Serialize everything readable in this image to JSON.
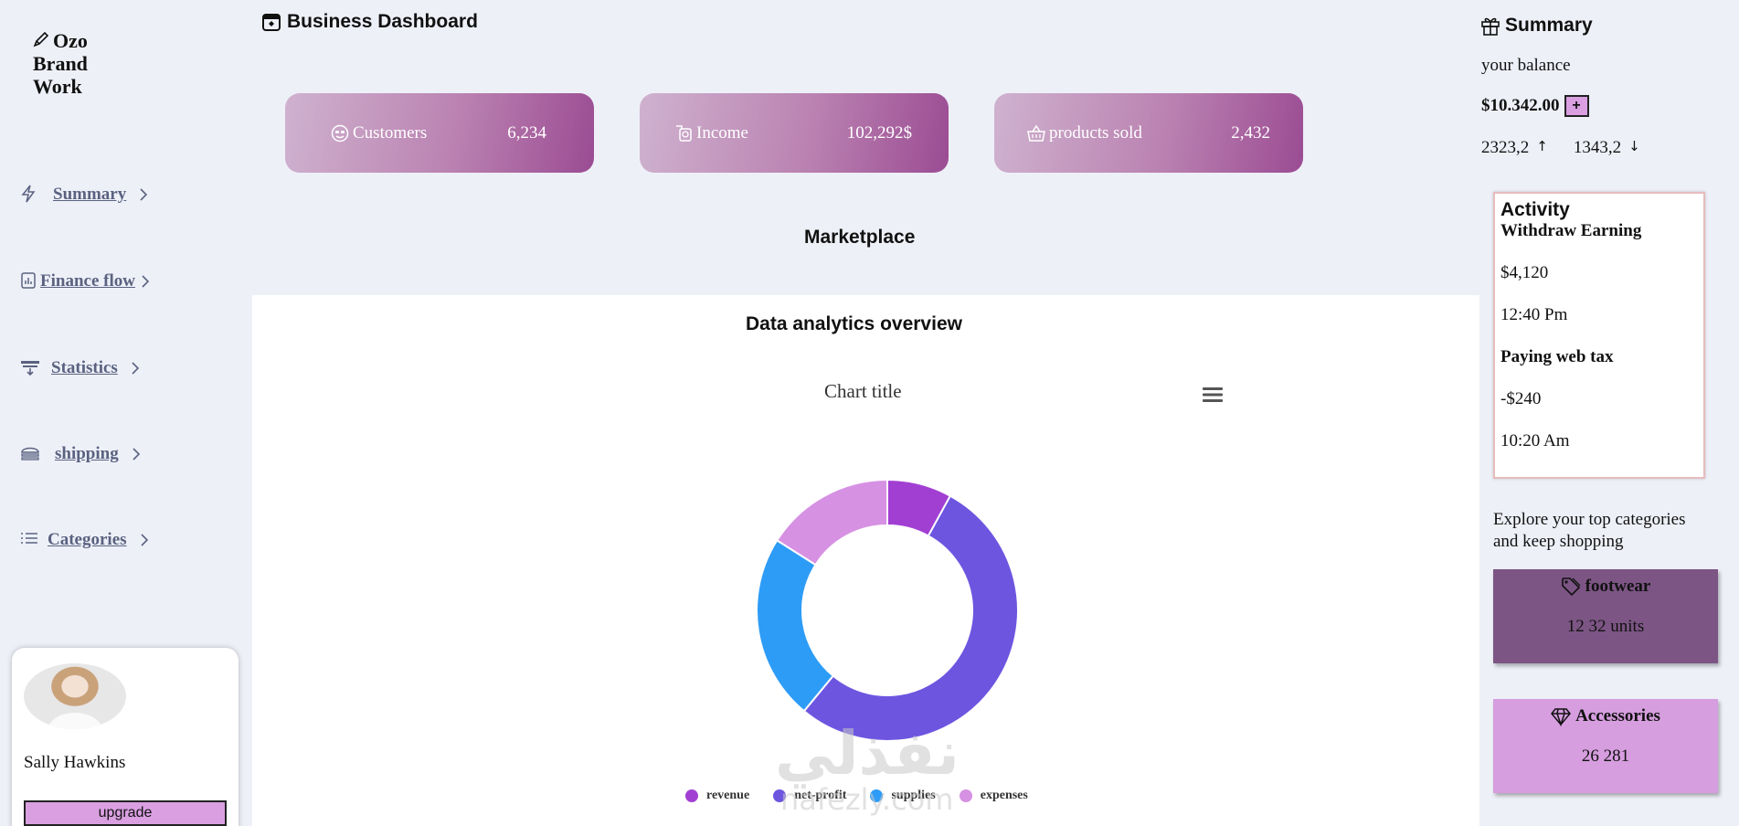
{
  "brand": {
    "name": "Ozo Brand Work",
    "icon": "pen-icon"
  },
  "sidebar": {
    "items": [
      {
        "label": "Summary",
        "icon": "lightning-icon"
      },
      {
        "label": "Finance flow",
        "icon": "finance-chart-icon"
      },
      {
        "label": "Statistics",
        "icon": "statistics-icon"
      },
      {
        "label": "shipping",
        "icon": "burger-icon"
      },
      {
        "label": "Categories",
        "icon": "list-icon"
      }
    ]
  },
  "profile": {
    "name": "Sally Hawkins",
    "upgrade_label": "upgrade"
  },
  "header": {
    "title": "Business Dashboard",
    "icon": "calendar-icon"
  },
  "stats": [
    {
      "label": "Customers",
      "value": "6,234",
      "icon": "smiley-icon"
    },
    {
      "label": "Income",
      "value": "102,292$",
      "icon": "cash-icon"
    },
    {
      "label": "products sold",
      "value": "2,432",
      "icon": "basket-icon"
    }
  ],
  "marketplace": {
    "title": "Marketplace"
  },
  "analytics": {
    "title": "Data analytics overview",
    "chart_menu_icon": "hamburger-menu-icon"
  },
  "chart_data": {
    "type": "pie",
    "title": "Chart title",
    "donut": true,
    "categories": [
      "revenue",
      "net-profit",
      "supplies",
      "expenses"
    ],
    "values": [
      8,
      53,
      23,
      16
    ],
    "colors": [
      "#a23fd3",
      "#6d55e0",
      "#2d9cf7",
      "#d691e3"
    ],
    "legend": "bottom"
  },
  "summary": {
    "title": "Summary",
    "icon": "gift-icon",
    "balance_label": "your balance",
    "balance": "$10.342.00",
    "plus_label": "+",
    "up_value": "2323,2",
    "down_value": "1343,2"
  },
  "activity": {
    "title": "Activity",
    "items": [
      {
        "title": "Withdraw Earning",
        "amount": "$4,120",
        "time": "12:40 Pm"
      },
      {
        "title": "Paying web tax",
        "amount": "-$240",
        "time": "10:20 Am"
      }
    ]
  },
  "explore": {
    "text": "Explore your top categories and keep shopping"
  },
  "categories": [
    {
      "name": "footwear",
      "units": "12 32 units",
      "icon": "tag-icon",
      "color": "#7c5584"
    },
    {
      "name": "Accessories",
      "units": "26 281",
      "icon": "diamond-icon",
      "color": "#d69ddf"
    }
  ],
  "watermark": {
    "arabic": "نفذلي",
    "latin": "nafezly.com"
  }
}
